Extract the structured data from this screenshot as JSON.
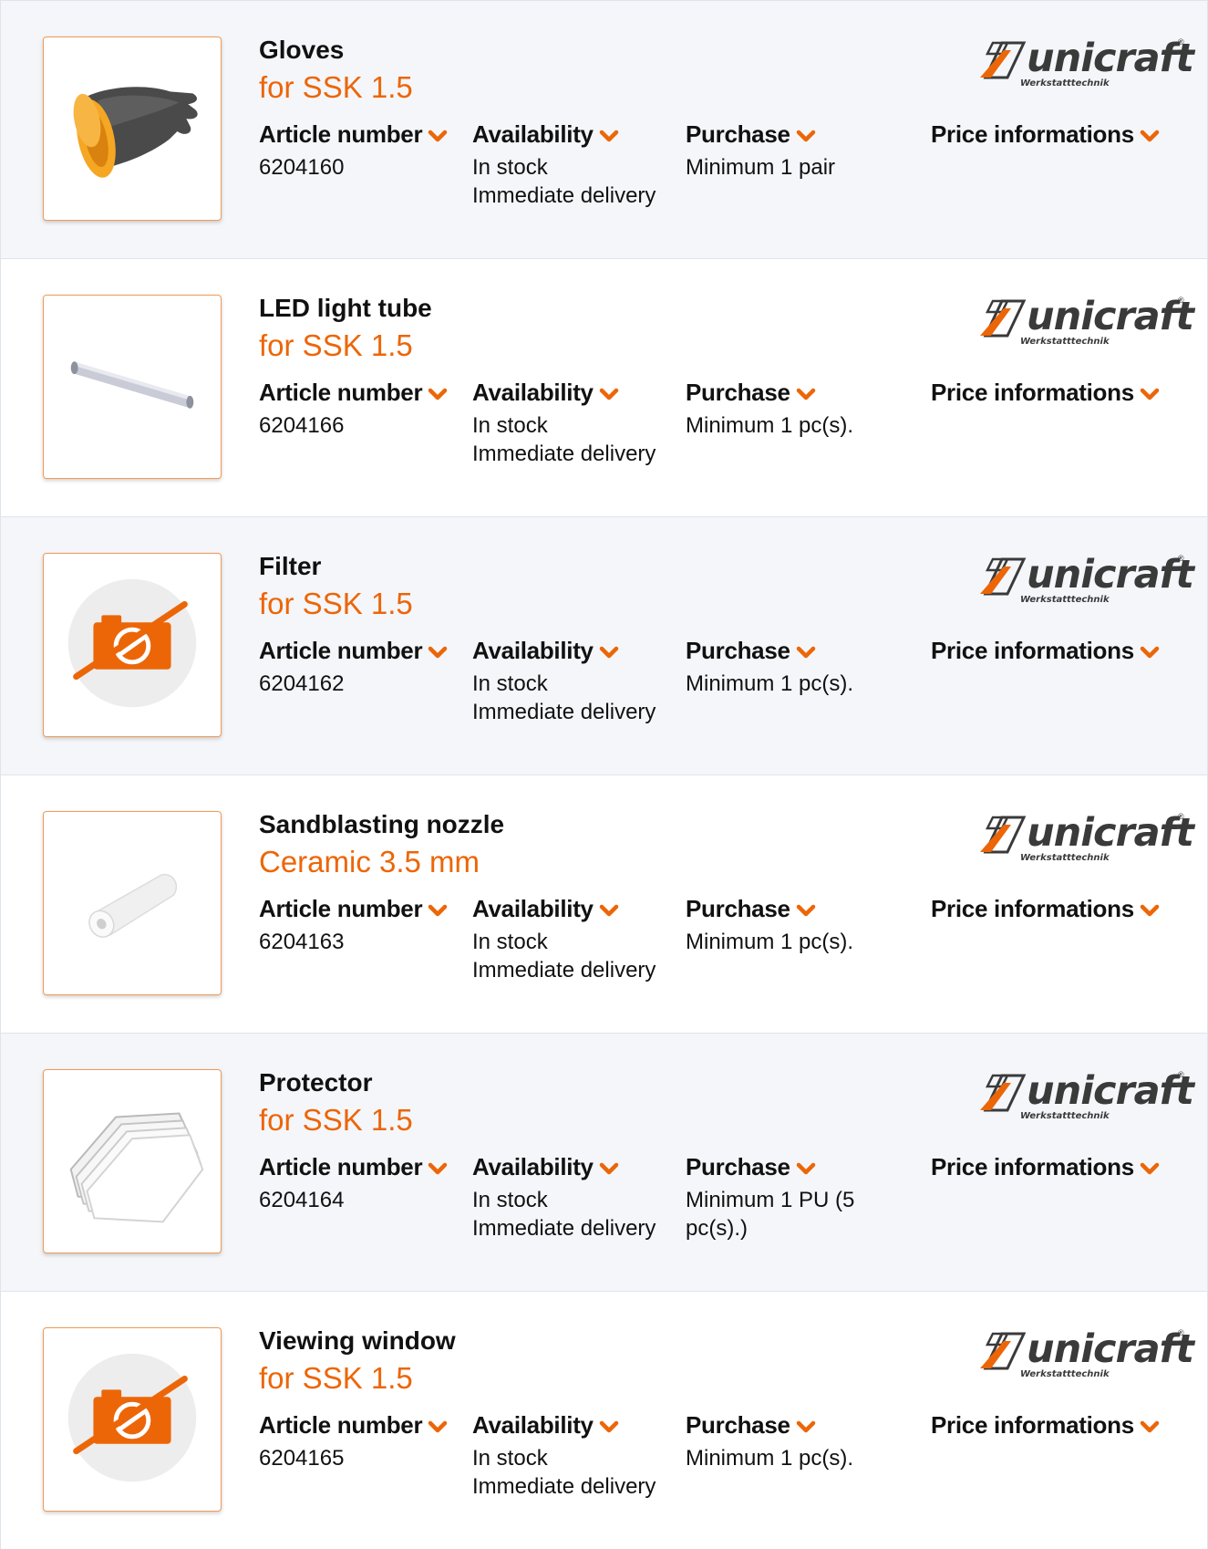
{
  "colors": {
    "accent": "#ec6608",
    "row_alt": "#f4f6fa",
    "row_border": "#dfe4ec",
    "text": "#111111"
  },
  "labels": {
    "article_number": "Article number",
    "availability": "Availability",
    "purchase": "Purchase",
    "price_informations": "Price informations"
  },
  "brand": {
    "name": "unicraft",
    "tagline": "Werkstatttechnik",
    "registered": "®"
  },
  "products": [
    {
      "title": "Gloves",
      "subtitle": "for SSK 1.5",
      "article_number": "6204160",
      "availability": "In stock",
      "delivery": "Immediate delivery",
      "purchase": "Minimum 1 pair",
      "image": "gloves-image"
    },
    {
      "title": "LED light tube",
      "subtitle": "for SSK 1.5",
      "article_number": "6204166",
      "availability": "In stock",
      "delivery": "Immediate delivery",
      "purchase": "Minimum 1 pc(s).",
      "image": "led-tube-image"
    },
    {
      "title": "Filter",
      "subtitle": "for SSK 1.5",
      "article_number": "6204162",
      "availability": "In stock",
      "delivery": "Immediate delivery",
      "purchase": "Minimum 1 pc(s).",
      "image": "no-image-placeholder-icon"
    },
    {
      "title": "Sandblasting nozzle",
      "subtitle": "Ceramic 3.5 mm",
      "article_number": "6204163",
      "availability": "In stock",
      "delivery": "Immediate delivery",
      "purchase": "Minimum 1 pc(s).",
      "image": "nozzle-image"
    },
    {
      "title": "Protector",
      "subtitle": "for SSK 1.5",
      "article_number": "6204164",
      "availability": "In stock",
      "delivery": "Immediate delivery",
      "purchase": "Minimum 1 PU (5 pc(s).)",
      "image": "protector-image"
    },
    {
      "title": "Viewing window",
      "subtitle": "for SSK 1.5",
      "article_number": "6204165",
      "availability": "In stock",
      "delivery": "Immediate delivery",
      "purchase": "Minimum 1 pc(s).",
      "image": "no-image-placeholder-icon"
    }
  ]
}
